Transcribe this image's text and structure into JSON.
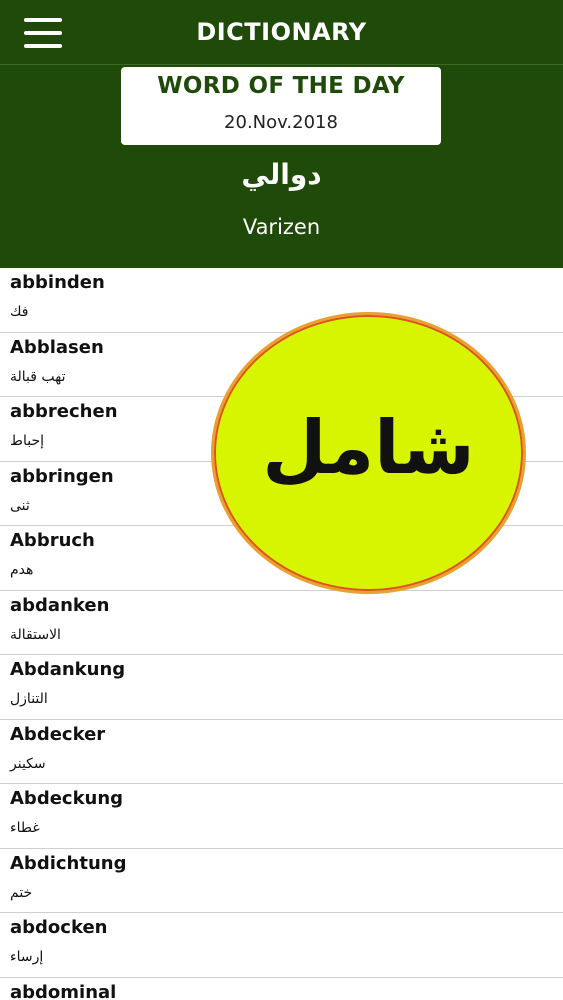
{
  "header": {
    "title": "DICTIONARY",
    "menu_icon": "hamburger-menu-icon"
  },
  "word_of_the_day": {
    "heading": "WORD OF THE DAY",
    "date": "20.Nov.2018",
    "arabic": "دوالي",
    "german": "Varizen"
  },
  "words": [
    {
      "de": "abbinden",
      "ar": "فك"
    },
    {
      "de": "Abblasen",
      "ar": "تهب قبالة"
    },
    {
      "de": "abbrechen",
      "ar": "إحباط"
    },
    {
      "de": "abbringen",
      "ar": "ثنى"
    },
    {
      "de": "Abbruch",
      "ar": "هدم"
    },
    {
      "de": "abdanken",
      "ar": "الاستقالة"
    },
    {
      "de": "Abdankung",
      "ar": "التنازل"
    },
    {
      "de": "Abdecker",
      "ar": "سكينر"
    },
    {
      "de": "Abdeckung",
      "ar": "غطاء"
    },
    {
      "de": "Abdichtung",
      "ar": "ختم"
    },
    {
      "de": "abdocken",
      "ar": "إرساء"
    },
    {
      "de": "abdominal",
      "ar": ""
    }
  ],
  "badge": {
    "text": "شامل",
    "fill_color": "#d8f500",
    "border_color": "#e05020"
  },
  "colors": {
    "header_bg": "#1f4a0a",
    "accent_text": "#1f4a0a"
  }
}
